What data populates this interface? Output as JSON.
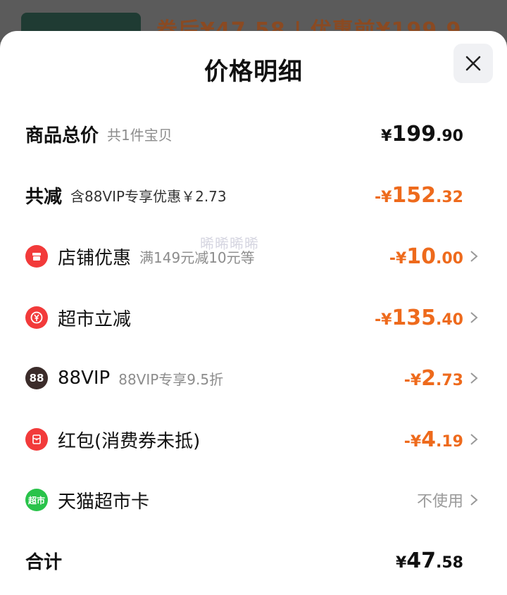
{
  "background_peek": {
    "text": "券后¥47.58 | 优惠前¥199.9"
  },
  "sheet": {
    "title": "价格明细",
    "close_label": "×"
  },
  "rows": {
    "total_price": {
      "label": "商品总价",
      "sub": "共1件宝贝",
      "currency": "¥",
      "int": "199",
      "dec": ".90"
    },
    "total_discount": {
      "label": "共减",
      "sub": "含88VIP专享优惠￥2.73",
      "currency": "-¥",
      "int": "152",
      "dec": ".32"
    },
    "store_discount": {
      "label": "店铺优惠",
      "sub": "满149元减10元等",
      "currency": "-¥",
      "int": "10",
      "dec": ".00"
    },
    "supermarket_discount": {
      "label": "超市立减",
      "currency": "-¥",
      "int": "135",
      "dec": ".40"
    },
    "vip": {
      "label": "88VIP",
      "sub": "88VIP专享9.5折",
      "icon_text": "88",
      "currency": "-¥",
      "int": "2",
      "dec": ".73"
    },
    "red_packet": {
      "label": "红包(消费券未抵)",
      "currency": "-¥",
      "int": "4",
      "dec": ".19"
    },
    "tmall_card": {
      "label": "天猫超市卡",
      "icon_text": "超市",
      "value": "不使用"
    },
    "grand_total": {
      "label": "合计",
      "currency": "¥",
      "int": "47",
      "dec": ".58"
    }
  },
  "watermark": "晞晞晞晞",
  "colors": {
    "accent_orange": "#ee6a1c",
    "icon_red": "#f23a3a",
    "icon_green": "#29c34a"
  }
}
